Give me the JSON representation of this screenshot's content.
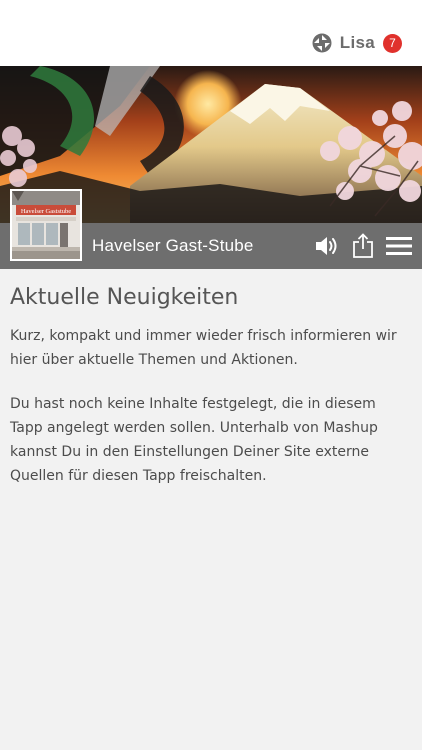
{
  "header": {
    "logo_icon": "tapp-logo-icon",
    "user_name": "Lisa",
    "notification_count": "7",
    "badge_color": "#e0312c"
  },
  "banner": {
    "image": "mountain-sunset-banner-image",
    "thumbnail": "storefront-thumbnail-image",
    "thumbnail_sign_text": "Havelser Gaststube",
    "site_title": "Havelser Gast-Stube",
    "bar_color": "#6e6e6e",
    "icons": [
      "speaker-icon",
      "share-icon",
      "menu-icon"
    ]
  },
  "main": {
    "heading": "Aktuelle Neuigkeiten",
    "intro": "Kurz, kompakt und immer wieder frisch informieren wir hier über aktuelle Themen und Aktionen.",
    "note": "Du hast noch keine Inhalte festgelegt, die in diesem Tapp angelegt werden sollen. Unterhalb von Mashup kannst Du in den Einstellungen Deiner Site externe Quellen für diesen Tapp freischalten."
  }
}
